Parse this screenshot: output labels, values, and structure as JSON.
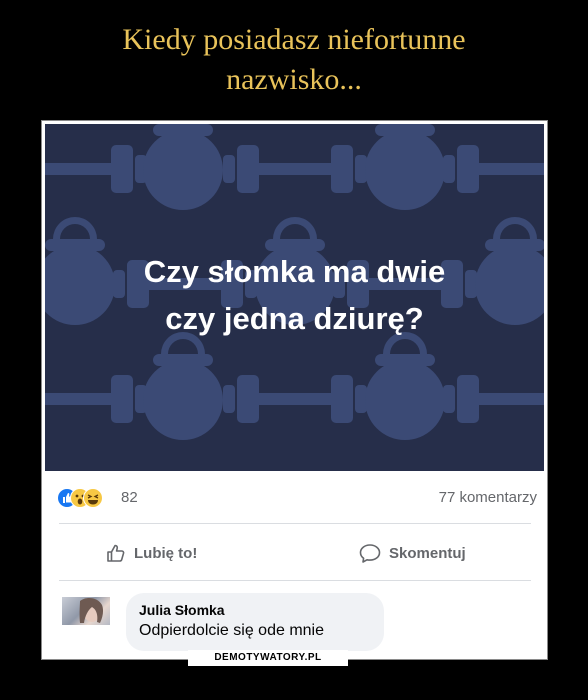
{
  "title_lines": [
    "Kiedy posiadasz niefortunne",
    "nazwisko..."
  ],
  "post": {
    "question_lines": [
      "Czy słomka ma dwie",
      "czy jedna dziurę?"
    ],
    "banner_color": "#262e4a",
    "reactions": {
      "icons": [
        "like-icon",
        "wow-icon",
        "haha-icon"
      ],
      "count": "82"
    },
    "comments_count": "77 komentarzy",
    "actions": {
      "like": "Lubię to!",
      "comment": "Skomentuj"
    }
  },
  "comment": {
    "author": "Julia Słomka",
    "text": "Odpierdolcie się ode mnie"
  },
  "watermark": "DEMOTYWATORY.PL",
  "colors": {
    "title": "#e9c35a",
    "accent": "#1877f2",
    "muted": "#65676b"
  }
}
